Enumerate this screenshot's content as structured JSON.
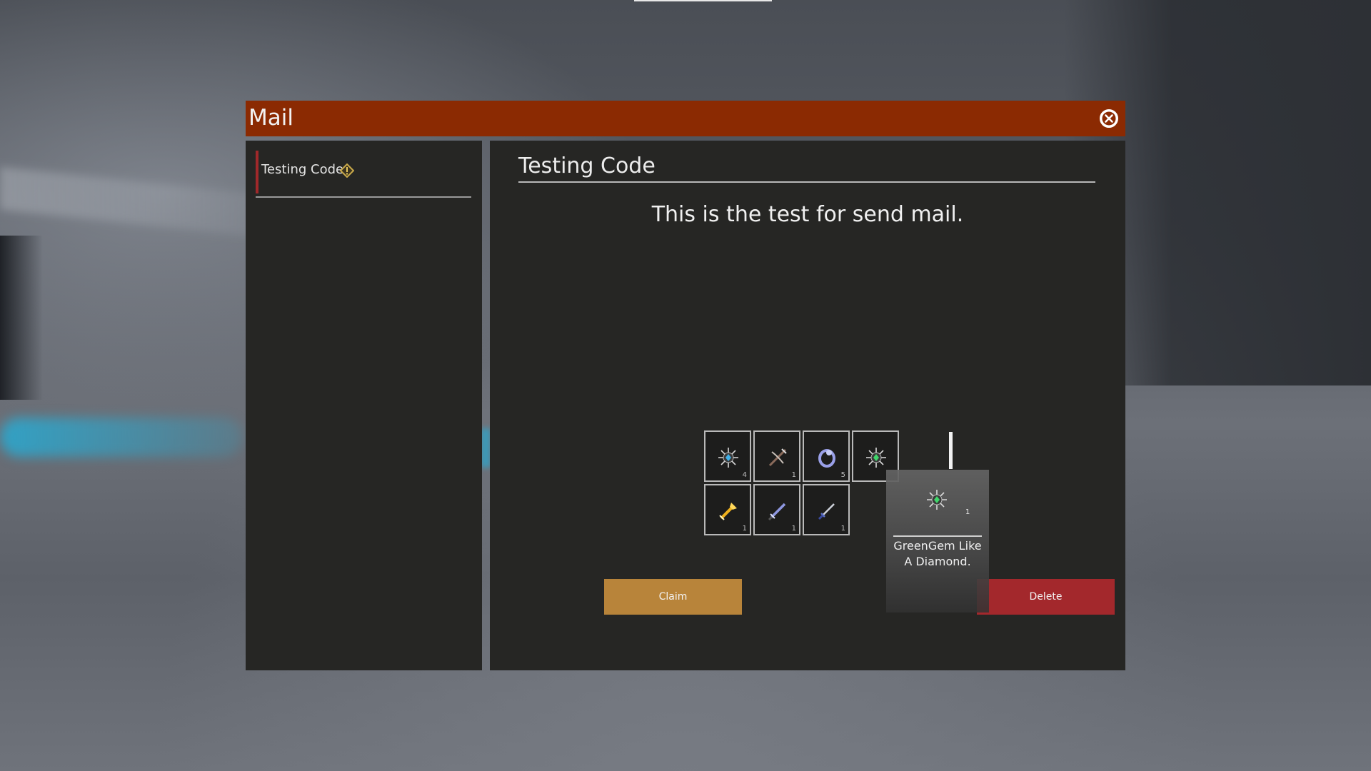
{
  "window": {
    "title": "Mail"
  },
  "mail_list": [
    {
      "label": "Testing Code",
      "icon": "warning-diamond-icon"
    }
  ],
  "message": {
    "subject": "Testing Code",
    "body": "This is the test for send mail."
  },
  "attachments": [
    {
      "icon": "blue-gem-icon",
      "quantity": "4"
    },
    {
      "icon": "crossbow-icon",
      "quantity": "1"
    },
    {
      "icon": "ring-icon",
      "quantity": "5"
    },
    {
      "icon": "green-gem-icon",
      "quantity": ""
    },
    {
      "icon": "gold-weapon-icon",
      "quantity": "1"
    },
    {
      "icon": "blue-sword-icon",
      "quantity": "1"
    },
    {
      "icon": "dagger-icon",
      "quantity": "1"
    }
  ],
  "buttons": {
    "claim": "Claim",
    "delete": "Delete"
  },
  "tooltip": {
    "icon": "green-gem-icon",
    "quantity": "1",
    "line1": "GreenGem Like",
    "line2": "A Diamond."
  },
  "colors": {
    "titlebar": "#8b2a02",
    "claim": "#b8843a",
    "delete": "#a3282c",
    "accent": "#a0282a"
  }
}
